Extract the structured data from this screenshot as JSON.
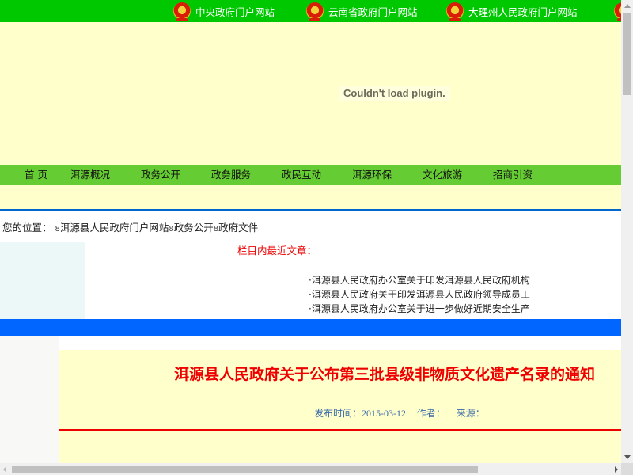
{
  "top_links": [
    {
      "label": "中央政府门户网站",
      "icon": "national-emblem-icon"
    },
    {
      "label": "云南省政府门户网站",
      "icon": "national-emblem-icon"
    },
    {
      "label": "大理州人民政府门户网站",
      "icon": "national-emblem-icon"
    }
  ],
  "banner": {
    "plugin_message": "Couldn't load plugin."
  },
  "nav": [
    "首 页",
    "洱源概况",
    "政务公开",
    "政务服务",
    "政民互动",
    "洱源环保",
    "文化旅游",
    "招商引资"
  ],
  "breadcrumb": {
    "label": "您的位置：",
    "separator": "8",
    "items": [
      "洱源县人民政府门户网站",
      "政务公开",
      "政府文件"
    ]
  },
  "recent": {
    "title": "栏目内最近文章：",
    "items": [
      "·洱源县人民政府办公室关于印发洱源县人民政府机构",
      "·洱源县人民政府关于印发洱源县人民政府领导成员工",
      "·洱源县人民政府办公室关于进一步做好近期安全生产"
    ]
  },
  "article": {
    "title": "洱源县人民政府关于公布第三批县级非物质文化遗产名录的通知",
    "publish_label": "发布时间：",
    "publish_date": "2015-03-12",
    "author_label": "作者：",
    "source_label": "来源："
  },
  "colors": {
    "top_bar": "#00c800",
    "nav_bar": "#66cc33",
    "band": "#ffffcc",
    "blue_band": "#0066ff",
    "accent_red": "#ee0000"
  }
}
